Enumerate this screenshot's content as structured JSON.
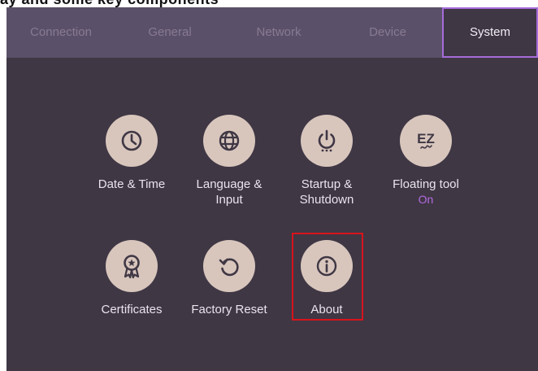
{
  "header": {
    "cut_text": "ay and some key components"
  },
  "tabs": [
    {
      "label": "Connection",
      "active": false
    },
    {
      "label": "General",
      "active": false
    },
    {
      "label": "Network",
      "active": false
    },
    {
      "label": "Device",
      "active": false
    },
    {
      "label": "System",
      "active": true
    }
  ],
  "tiles": [
    {
      "label": "Date & Time",
      "icon": "clock-icon"
    },
    {
      "label": "Language & Input",
      "icon": "globe-icon"
    },
    {
      "label": "Startup & Shutdown",
      "icon": "power-icon"
    },
    {
      "label": "Floating tool",
      "sublabel": "On",
      "icon": "ez-icon"
    },
    {
      "label": "Certificates",
      "icon": "certificate-icon"
    },
    {
      "label": "Factory Reset",
      "icon": "reset-icon"
    },
    {
      "label": "About",
      "icon": "info-icon",
      "highlighted": true
    }
  ],
  "colors": {
    "background": "#3f3744",
    "tabbar": "#5b5069",
    "accent": "#a66bd9",
    "icon_circle": "#d8c6bd",
    "icon_glyph": "#3f3744",
    "highlight": "#d8141c"
  }
}
